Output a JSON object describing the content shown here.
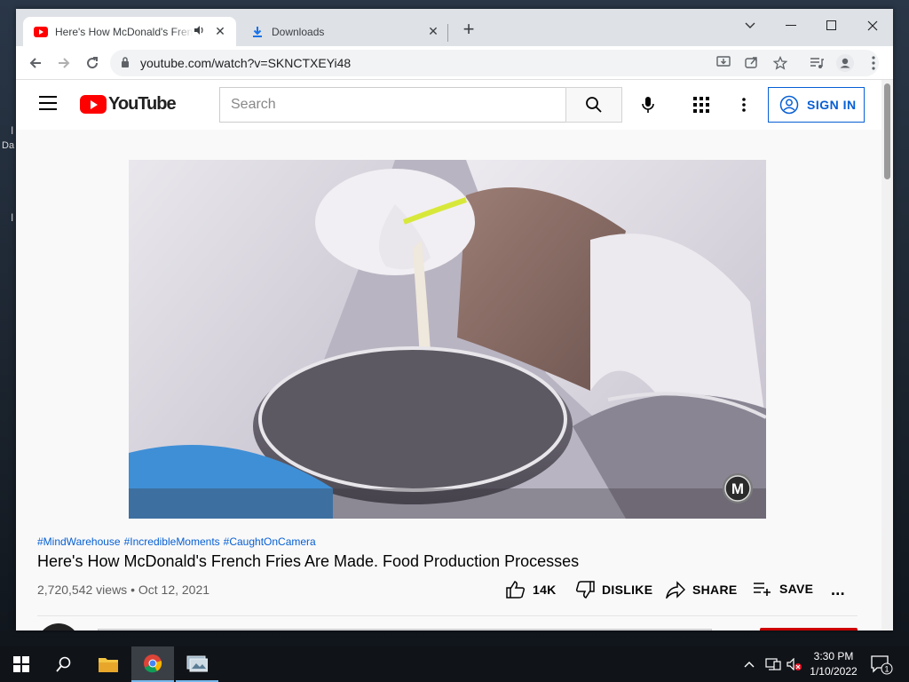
{
  "browser": {
    "tabs": [
      {
        "title": "Here's How McDonald's French Fries Are Made",
        "active": true,
        "audio": true
      },
      {
        "title": "Downloads",
        "active": false
      }
    ],
    "new_tab_label": "+",
    "url": "youtube.com/watch?v=SKNCTXEYi48"
  },
  "youtube": {
    "search_placeholder": "Search",
    "sign_in_label": "SIGN IN",
    "hashtags": [
      "#MindWarehouse",
      "#IncredibleMoments",
      "#CaughtOnCamera"
    ],
    "video_title": "Here's How McDonald's French Fries Are Made. Food Production Processes",
    "views": "2,720,542 views",
    "date_separator": "•",
    "date": "Oct 12, 2021",
    "actions": {
      "like_count": "14K",
      "dislike_label": "DISLIKE",
      "share_label": "SHARE",
      "save_label": "SAVE",
      "more_label": "..."
    },
    "watermark_letter": "M"
  },
  "taskbar": {
    "time": "3:30 PM",
    "date": "1/10/2022",
    "notification_count": "1"
  },
  "desktop": {
    "edge_text": "Da"
  },
  "colors": {
    "youtube_red": "#ff0000",
    "link_blue": "#065fd4",
    "tab_strip": "#dee1e6"
  }
}
